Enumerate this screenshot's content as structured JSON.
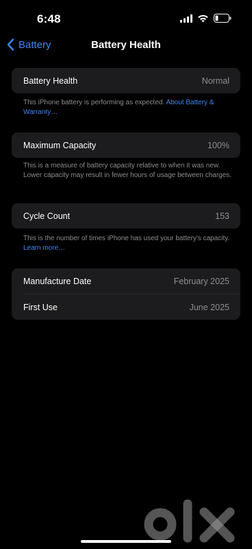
{
  "status": {
    "time": "6:48"
  },
  "nav": {
    "back_label": "Battery",
    "title": "Battery Health"
  },
  "health": {
    "label": "Battery Health",
    "value": "Normal",
    "note": "This iPhone battery is performing as expected.",
    "link": "About Battery & Warranty…"
  },
  "capacity": {
    "label": "Maximum Capacity",
    "value": "100%",
    "note": "This is a measure of battery capacity relative to when it was new. Lower capacity may result in fewer hours of usage between charges."
  },
  "cycle": {
    "label": "Cycle Count",
    "value": "153",
    "note": "This is the number of times iPhone has used your battery's capacity.",
    "link": "Learn more…"
  },
  "dates": {
    "manufacture_label": "Manufacture Date",
    "manufacture_value": "February 2025",
    "first_use_label": "First Use",
    "first_use_value": "June 2025"
  },
  "watermark": {
    "text": "olx"
  },
  "colors": {
    "accent": "#3f86f6",
    "cell": "#1c1c1e",
    "secondary": "#8e8e93"
  }
}
